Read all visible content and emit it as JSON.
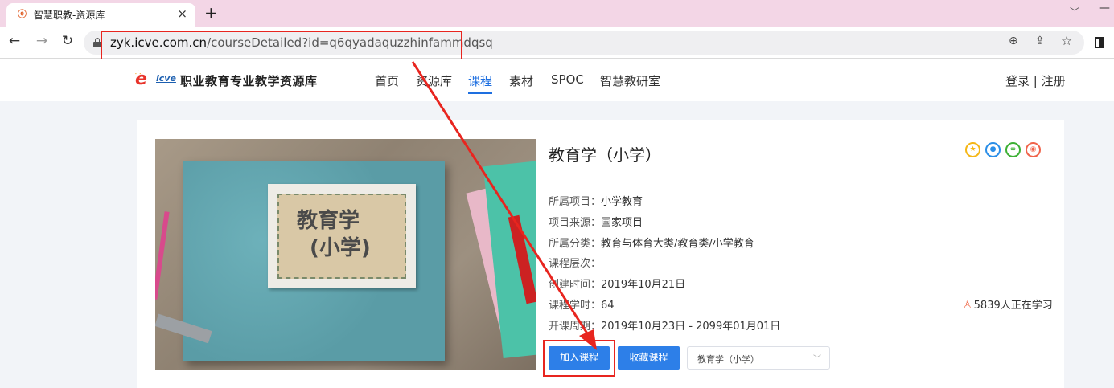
{
  "browser": {
    "tab_title": "智慧职教-资源库",
    "tab_close": "×",
    "new_tab": "+",
    "url_host": "zyk.icve.com.cn",
    "url_path": "/courseDetailed?id=q6qyadaquzzhinfammdqsq"
  },
  "site": {
    "logo_icve": "icve",
    "logo_text": "职业教育专业教学资源库",
    "nav": [
      "首页",
      "资源库",
      "课程",
      "素材",
      "SPOC",
      "智慧教研室"
    ],
    "active_nav": "课程",
    "login": "登录 | 注册"
  },
  "course": {
    "cover_title": "教育学",
    "cover_sub": "(小学)",
    "title": "教育学（小学）",
    "meta": [
      {
        "key": "所属项目：",
        "value": "小学教育"
      },
      {
        "key": "项目来源：",
        "value": "国家项目"
      },
      {
        "key": "所属分类：",
        "value": "教育与体育大类/教育类/小学教育"
      },
      {
        "key": "课程层次：",
        "value": ""
      },
      {
        "key": "创建时间：",
        "value": "2019年10月21日"
      },
      {
        "key": "课程学时：",
        "value": "64"
      },
      {
        "key": "开课周期：",
        "value": "2019年10月23日 - 2099年01月01日"
      }
    ],
    "learners": "5839人正在学习",
    "join_button": "加入课程",
    "favorite_button": "收藏课程",
    "select_value": "教育学（小学）"
  },
  "colors": {
    "accent": "#2d7fe8",
    "annotation": "#e8251f",
    "tab_strip": "#f3d6e6"
  }
}
